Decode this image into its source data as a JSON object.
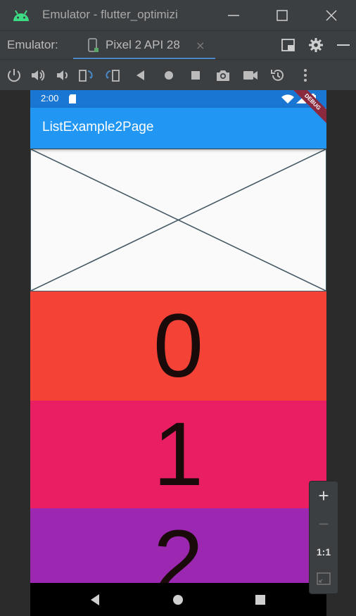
{
  "window": {
    "title": "Emulator - flutter_optimizi",
    "buttons": [
      "minimize-icon",
      "maximize-icon",
      "close-icon"
    ]
  },
  "tabbar": {
    "label": "Emulator:",
    "tab_label": "Pixel 2 API 28",
    "tab_close": "×"
  },
  "toolbar": {
    "icons": [
      "power-icon",
      "volume-up-icon",
      "volume-down-icon",
      "rotate-left-icon",
      "rotate-right-icon",
      "back-icon",
      "home-icon",
      "overview-icon",
      "camera-icon",
      "video-icon",
      "snapshot-icon",
      "more-icon"
    ]
  },
  "phone": {
    "status_time": "2:00",
    "app_title": "ListExample2Page",
    "debug_banner": "DEBUG",
    "items": [
      {
        "label": "0",
        "color": "#f44336"
      },
      {
        "label": "1",
        "color": "#e91e63"
      },
      {
        "label": "2",
        "color": "#9c27b0"
      }
    ]
  },
  "zoom": {
    "zoom_in": "+",
    "zoom_out": "−",
    "actual_size": "1:1"
  },
  "colors": {
    "ide_bg": "#3c3f41",
    "app_bar": "#2196f3",
    "status_bar": "#1976d2",
    "accent": "#4a88c7"
  }
}
